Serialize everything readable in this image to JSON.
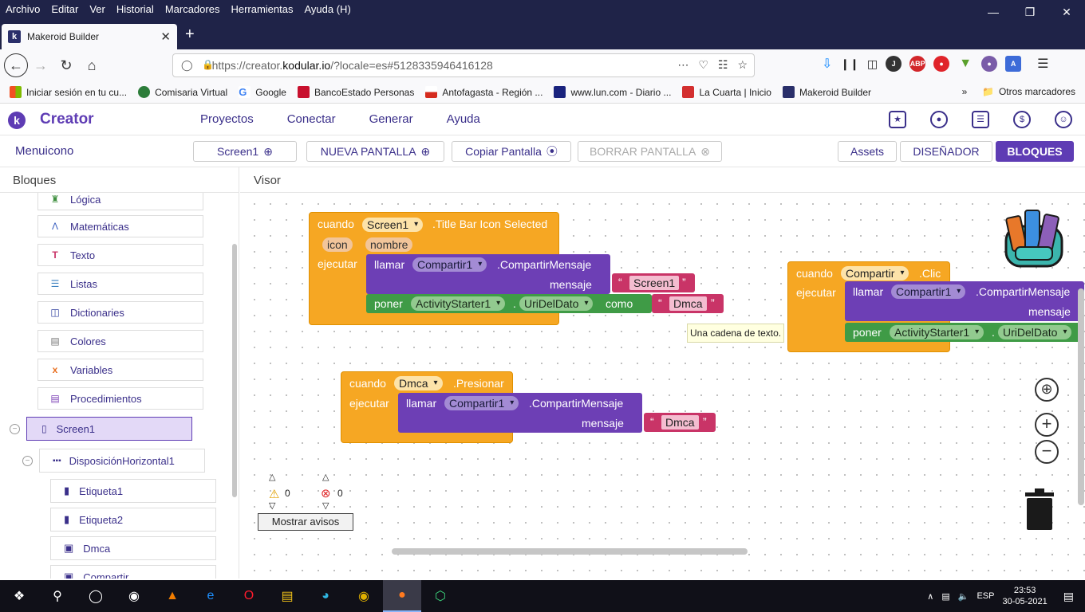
{
  "menubar": [
    "Archivo",
    "Editar",
    "Ver",
    "Historial",
    "Marcadores",
    "Herramientas",
    "Ayuda (H)"
  ],
  "tab": {
    "title": "Makeroid Builder"
  },
  "url": {
    "prefix": "https://creator.",
    "domain": "kodular.io",
    "suffix": "/?locale=es#5128335946416128"
  },
  "bookmarks": [
    "Iniciar sesión en tu cu...",
    "Comisaria Virtual",
    "Google",
    "BancoEstado Personas",
    "Antofagasta - Región ...",
    "www.lun.com - Diario ...",
    "La Cuarta | Inicio",
    "Makeroid Builder"
  ],
  "bookmarks_other": "Otros marcadores",
  "app": {
    "name": "Creator",
    "nav": [
      "Proyectos",
      "Conectar",
      "Generar",
      "Ayuda"
    ]
  },
  "toolbar": {
    "project": "Menuicono",
    "screen": "Screen1",
    "new_screen": "NUEVA PANTALLA",
    "copy_screen": "Copiar Pantalla",
    "delete_screen": "BORRAR PANTALLA",
    "assets": "Assets",
    "designer": "DISEÑADOR",
    "blocks": "BLOQUES"
  },
  "left_panel": {
    "title": "Bloques",
    "builtins": [
      "Lógica",
      "Matemáticas",
      "Texto",
      "Listas",
      "Dictionaries",
      "Colores",
      "Variables",
      "Procedimientos"
    ],
    "tree": {
      "screen": "Screen1",
      "arrangement": "DisposiciónHorizontal1",
      "children": [
        "Etiqueta1",
        "Etiqueta2",
        "Dmca",
        "Compartir"
      ]
    }
  },
  "viewer": {
    "title": "Visor"
  },
  "blocks": {
    "when": "cuando",
    "do": "ejecutar",
    "call": "llamar",
    "set": "poner",
    "to": "como",
    "message": "mensaje",
    "b1": {
      "component": "Screen1",
      "event": ".Title Bar Icon Selected",
      "param1": "icon",
      "param2": "nombre",
      "call_comp": "Compartir1",
      "call_method": ".CompartirMensaje",
      "msg": "Screen1",
      "set_comp": "ActivityStarter1",
      "set_prop": "UriDelDato",
      "set_val": "Dmca"
    },
    "b2": {
      "component": "Compartir",
      "event": ".Clic",
      "call_comp": "Compartir1",
      "call_method": ".CompartirMensaje",
      "set_comp": "ActivityStarter1",
      "set_prop": "UriDelDato"
    },
    "b3": {
      "component": "Dmca",
      "event": ".Presionar",
      "call_comp": "Compartir1",
      "call_method": ".CompartirMensaje",
      "msg": "Dmca"
    }
  },
  "tooltip": "Una cadena de texto.",
  "warnings": {
    "warn_count": "0",
    "error_count": "0",
    "button": "Mostrar avisos"
  },
  "taskbar": {
    "lang": "ESP",
    "time": "23:53",
    "date": "30-05-2021"
  }
}
